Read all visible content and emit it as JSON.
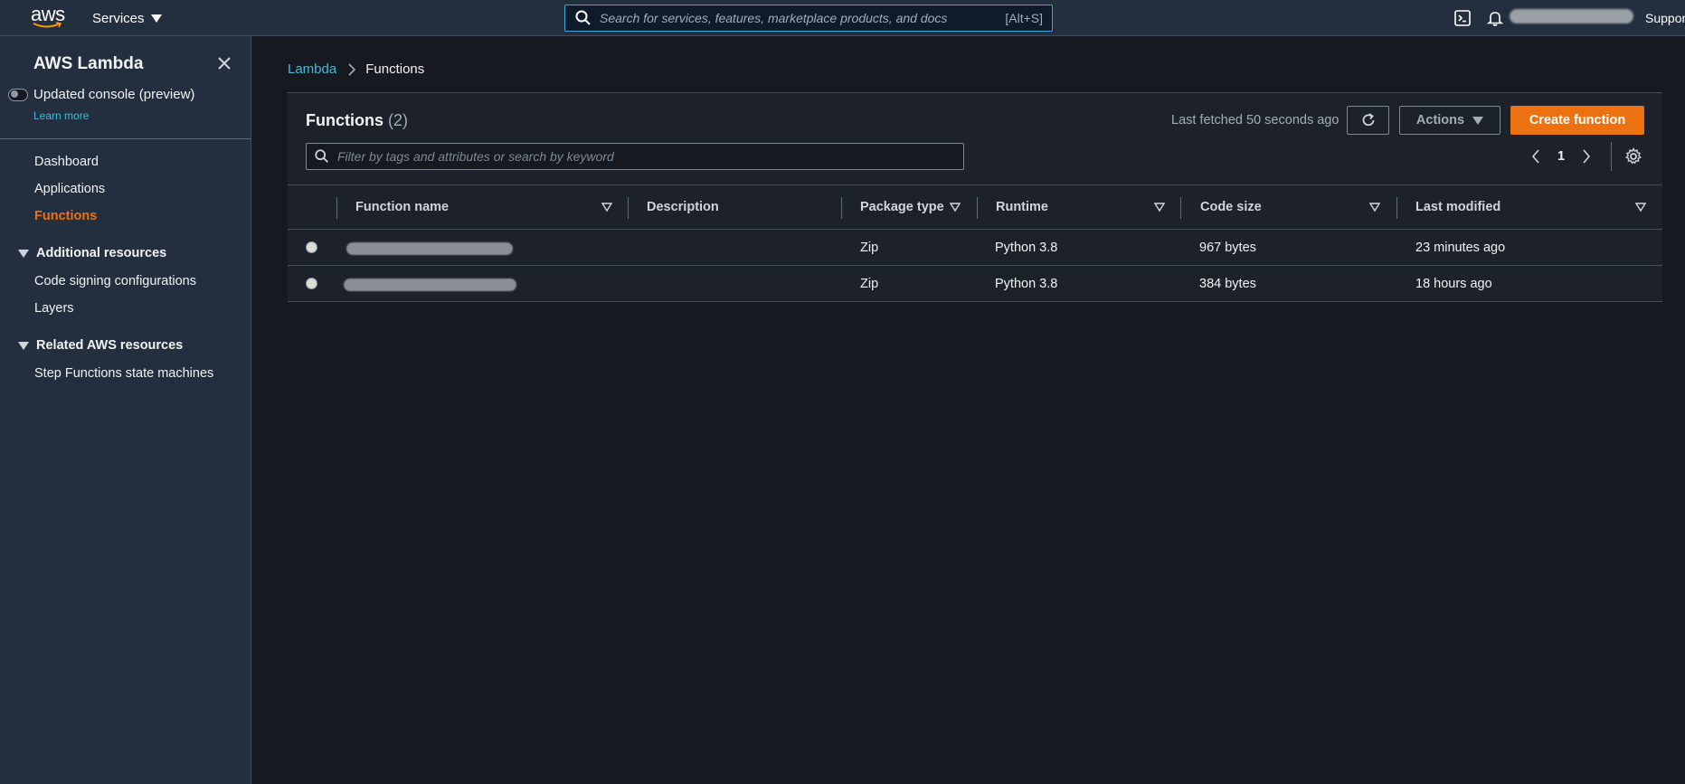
{
  "topnav": {
    "logo_text": "aws",
    "services_label": "Services",
    "search_placeholder": "Search for services, features, marketplace products, and docs",
    "search_shortcut": "[Alt+S]",
    "support_label": "Support"
  },
  "sidebar": {
    "title": "AWS Lambda",
    "toggle_label": "Updated console (preview)",
    "learn_more": "Learn more",
    "items": [
      {
        "label": "Dashboard"
      },
      {
        "label": "Applications"
      },
      {
        "label": "Functions",
        "active": true
      }
    ],
    "sections": [
      {
        "label": "Additional resources",
        "items": [
          {
            "label": "Code signing configurations"
          },
          {
            "label": "Layers"
          }
        ]
      },
      {
        "label": "Related AWS resources",
        "items": [
          {
            "label": "Step Functions state machines"
          }
        ]
      }
    ]
  },
  "breadcrumb": {
    "root": "Lambda",
    "current": "Functions"
  },
  "panel": {
    "title": "Functions",
    "count": "(2)",
    "last_fetched": "Last fetched 50 seconds ago",
    "actions_label": "Actions",
    "create_label": "Create function",
    "filter_placeholder": "Filter by tags and attributes or search by keyword",
    "page_number": "1"
  },
  "table": {
    "columns": [
      "Function name",
      "Description",
      "Package type",
      "Runtime",
      "Code size",
      "Last modified"
    ],
    "rows": [
      {
        "package_type": "Zip",
        "runtime": "Python 3.8",
        "code_size": "967 bytes",
        "last_modified": "23 minutes ago"
      },
      {
        "package_type": "Zip",
        "runtime": "Python 3.8",
        "code_size": "384 bytes",
        "last_modified": "18 hours ago"
      }
    ]
  },
  "colors": {
    "nav_bg": "#232f3e",
    "page_bg": "#16191f",
    "accent_orange": "#ec7211",
    "link_blue": "#44b9d6"
  },
  "icons": [
    "search-icon",
    "cloudshell-icon",
    "bell-icon",
    "close-icon",
    "refresh-icon",
    "chevron-left-icon",
    "chevron-right-icon",
    "gear-icon",
    "sort-icon",
    "caret-down-icon"
  ]
}
